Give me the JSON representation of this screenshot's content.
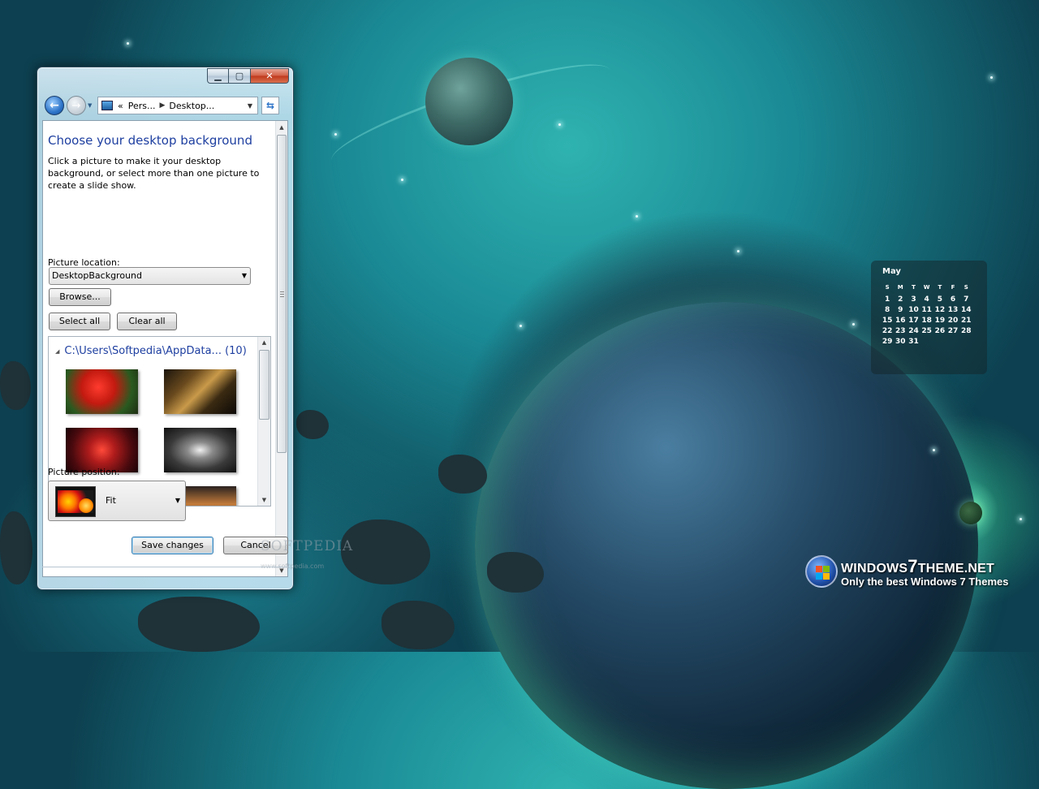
{
  "window": {
    "nav": {
      "breadcrumb_prefix": "«",
      "crumb1": "Pers...",
      "crumb2": "Desktop..."
    },
    "heading": "Choose your desktop background",
    "description": "Click a picture to make it your desktop background, or select more than one picture to create a slide show.",
    "picture_location_label": "Picture location:",
    "picture_location_value": "DesktopBackground",
    "browse_label": "Browse...",
    "select_all_label": "Select all",
    "clear_all_label": "Clear all",
    "group_header": "C:\\Users\\Softpedia\\AppData... (10)",
    "picture_position_label": "Picture position:",
    "picture_position_value": "Fit",
    "save_label": "Save changes",
    "cancel_label": "Cancel"
  },
  "watermark": {
    "text": "SOFTPEDIA",
    "url": "www.softpedia.com"
  },
  "calendar": {
    "month": "May",
    "weekdays": [
      "S",
      "M",
      "T",
      "W",
      "T",
      "F",
      "S"
    ],
    "days": [
      "1",
      "2",
      "3",
      "4",
      "5",
      "6",
      "7",
      "8",
      "9",
      "10",
      "11",
      "12",
      "13",
      "14",
      "15",
      "16",
      "17",
      "18",
      "19",
      "20",
      "21",
      "22",
      "23",
      "24",
      "25",
      "26",
      "27",
      "28",
      "29",
      "30",
      "31"
    ]
  },
  "brand": {
    "title_a": "WINDOWS",
    "title_b": "7",
    "title_c": "THEME.NET",
    "subtitle": "Only the best Windows 7 Themes"
  }
}
